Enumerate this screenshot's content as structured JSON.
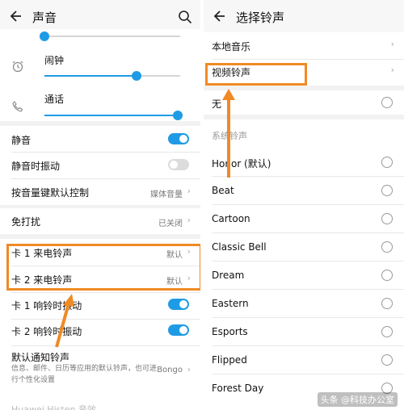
{
  "left": {
    "title": "声音",
    "alarm_label": "闹钟",
    "call_label": "通话",
    "alarm_level": 0.68,
    "call_level": 0.98,
    "top_level": 0.0,
    "mute_label": "静音",
    "mute_on": true,
    "vibrate_when_muted_label": "静音时振动",
    "vibrate_when_muted_on": false,
    "volume_key_label": "按音量键默认控制",
    "volume_key_value": "媒体音量",
    "dnd_label": "免打扰",
    "dnd_value": "已关闭",
    "sim1_ringtone_label": "卡 1 来电铃声",
    "sim1_ringtone_value": "默认",
    "sim2_ringtone_label": "卡 2 来电铃声",
    "sim2_ringtone_value": "默认",
    "sim1_vibrate_label": "卡 1 响铃时振动",
    "sim2_vibrate_label": "卡 2 响铃时振动",
    "notification_label": "默认通知铃声",
    "notification_value": "Bongo",
    "notification_desc": "信息、邮件、日历等应用的默认铃声，也可进行个性化设置",
    "bottom_partial": "Huawei Histen 音效"
  },
  "right": {
    "title": "选择铃声",
    "local_music": "本地音乐",
    "video_ringtone": "视频铃声",
    "none": "无",
    "section": "系统铃声",
    "ringtones": [
      "Honor (默认)",
      "Beat",
      "Cartoon",
      "Classic Bell",
      "Dream",
      "Eastern",
      "Esports",
      "Flipped",
      "Forest Day"
    ]
  },
  "watermark": "头条 @科技办公室",
  "colors": {
    "accent": "#1f9be6",
    "highlight": "#f08a24"
  }
}
